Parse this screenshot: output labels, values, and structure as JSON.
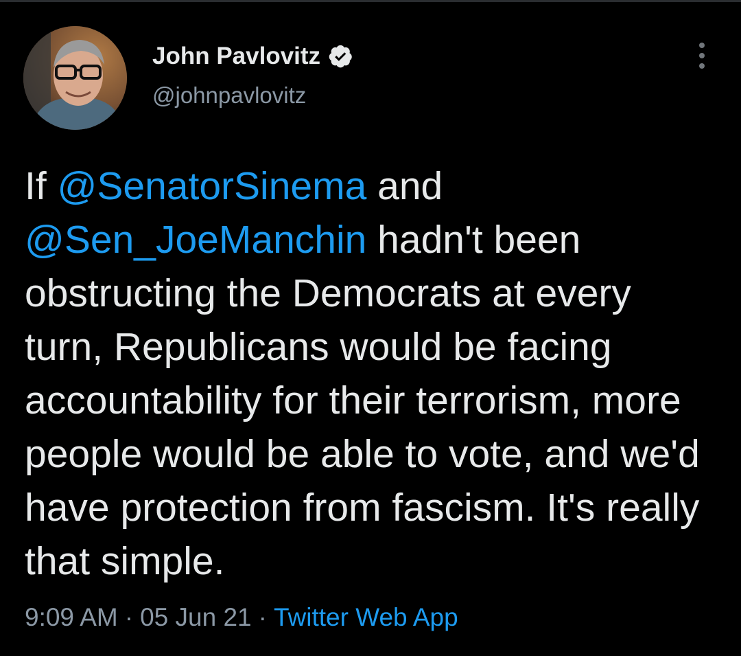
{
  "author": {
    "display_name": "John Pavlovitz",
    "handle": "@johnpavlovitz",
    "verified": true,
    "avatar_icon": "profile-photo-man-with-glasses"
  },
  "tweet": {
    "segments": [
      {
        "text": "If ",
        "type": "text"
      },
      {
        "text": "@SenatorSinema",
        "type": "mention"
      },
      {
        "text": " and ",
        "type": "text"
      },
      {
        "text": "@Sen_JoeManchin",
        "type": "mention"
      },
      {
        "text": " hadn't been obstructing the Democrats at every turn, Republicans would be facing accountability for their terrorism, more people would be able to vote, and we'd have protection from fascism. It's really that simple.",
        "type": "text"
      }
    ]
  },
  "meta": {
    "time": "9:09 AM",
    "separator": "·",
    "date": "05 Jun 21",
    "source": "Twitter Web App"
  },
  "colors": {
    "background": "#000000",
    "text": "#e7e9ea",
    "secondary": "#8b98a5",
    "accent": "#1d9bf0"
  },
  "icons": {
    "verified": "verified-badge-icon",
    "more": "more-options-vertical-icon"
  }
}
